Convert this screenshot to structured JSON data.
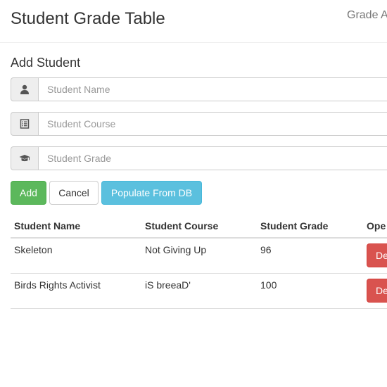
{
  "header": {
    "title": "Student Grade Table",
    "right_text": "Grade A"
  },
  "form": {
    "title": "Add Student",
    "fields": [
      {
        "placeholder": "Student Name",
        "value": "",
        "icon": "user-icon"
      },
      {
        "placeholder": "Student Course",
        "value": "",
        "icon": "list-alt-icon"
      },
      {
        "placeholder": "Student Grade",
        "value": "",
        "icon": "graduation-cap-icon"
      }
    ],
    "buttons": {
      "add": "Add",
      "cancel": "Cancel",
      "populate": "Populate From DB"
    }
  },
  "table": {
    "headers": [
      "Student Name",
      "Student Course",
      "Student Grade",
      "Ope"
    ],
    "rows": [
      {
        "name": "Skeleton",
        "course": "Not Giving Up",
        "grade": "96",
        "action": "De"
      },
      {
        "name": "Birds Rights Activist",
        "course": "iS breeaD'",
        "grade": "100",
        "action": "De"
      }
    ]
  },
  "colors": {
    "add": "#5cb85c",
    "populate": "#5bc0de",
    "delete": "#d9534f"
  }
}
